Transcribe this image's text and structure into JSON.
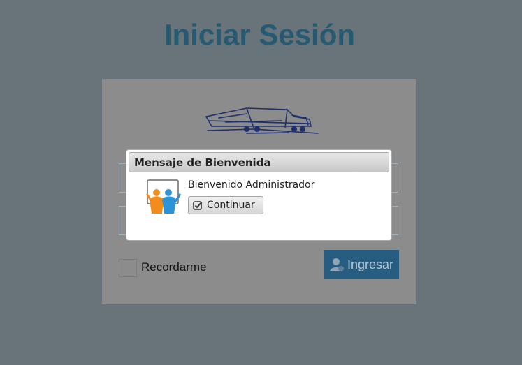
{
  "page": {
    "title": "Iniciar Sesión",
    "background_color": "#68737a",
    "title_color": "#265a72"
  },
  "login_form": {
    "logo_icon": "truck-logo",
    "remember_label": "Recordarme",
    "submit_label": "Ingresar",
    "submit_icon": "user-icon",
    "submit_color": "#285d82"
  },
  "dialog": {
    "title": "Mensaje de Bienvenida",
    "message": "Bienvenido Administrador",
    "icon": "people-board-icon",
    "button_label": "Continuar",
    "button_icon": "check-square-icon"
  }
}
